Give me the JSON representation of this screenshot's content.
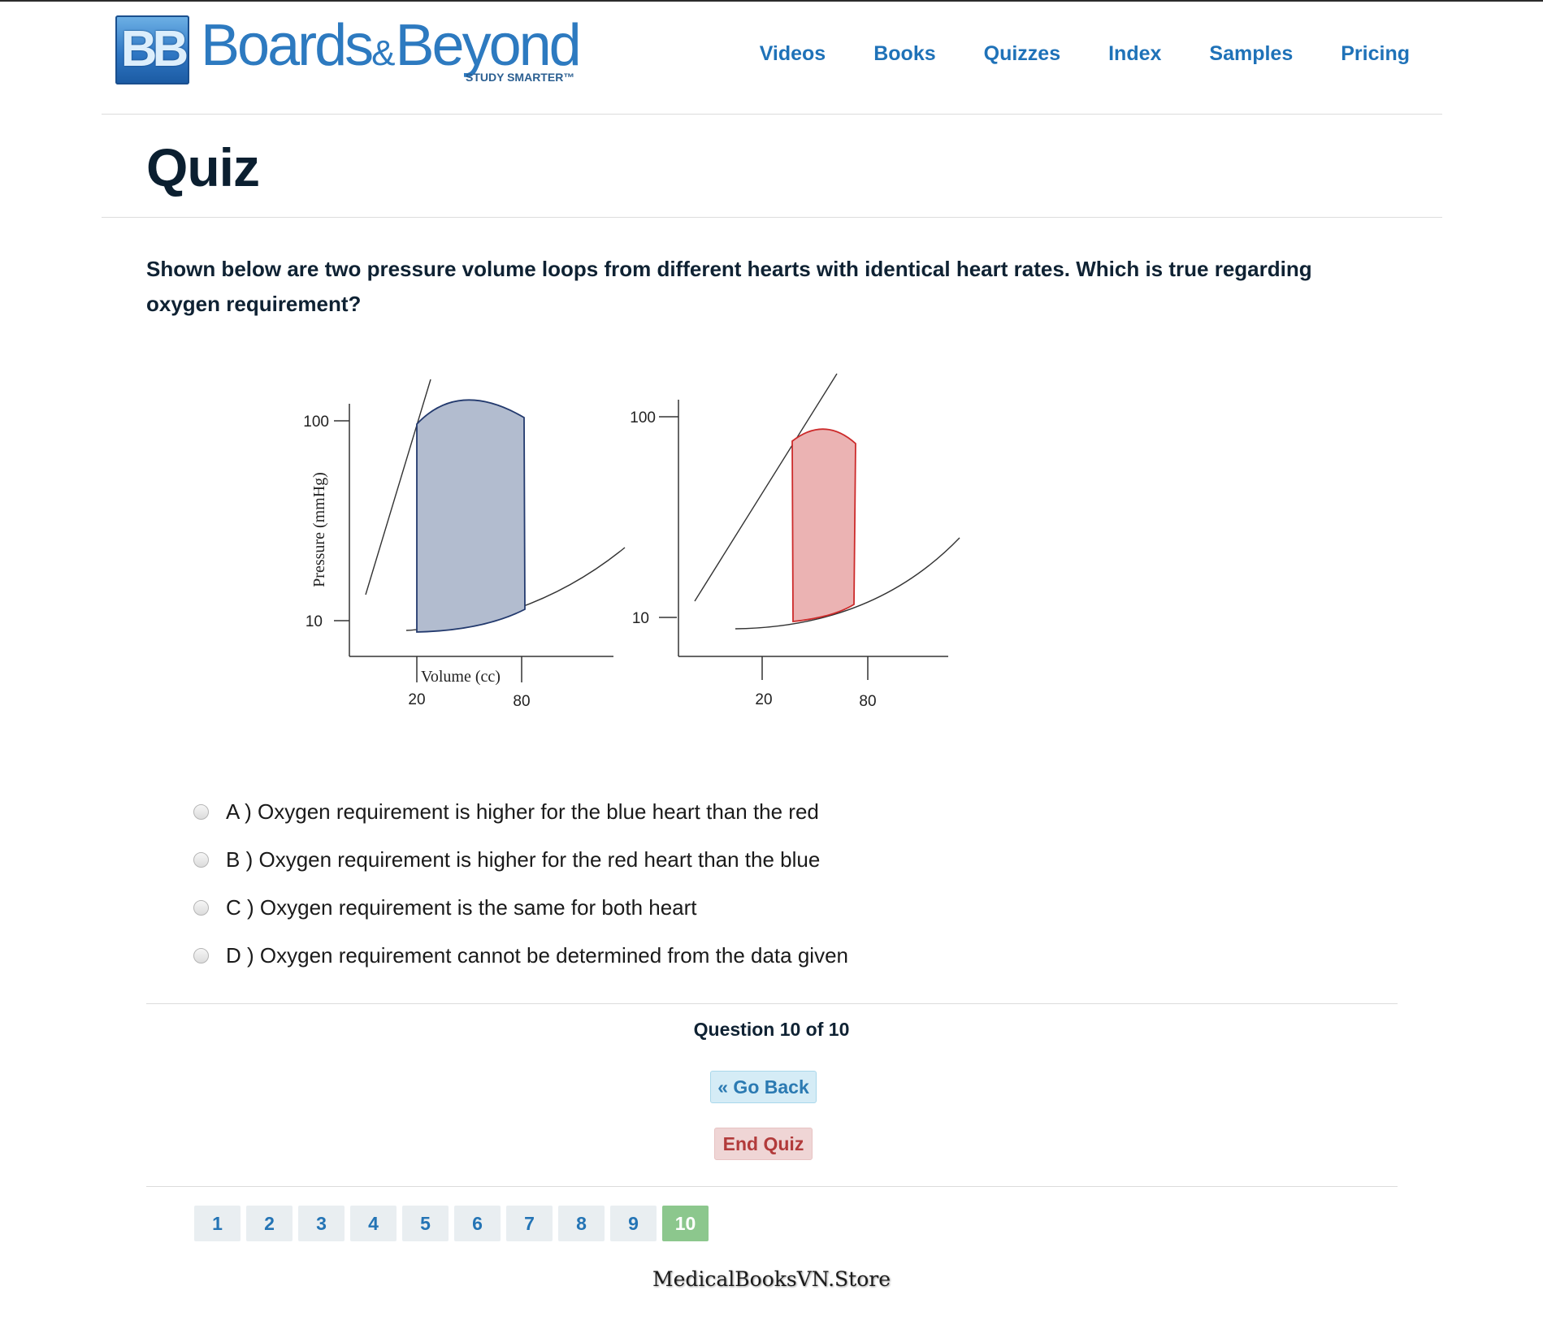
{
  "brand": {
    "badge": "BB",
    "name_part1": "Boards",
    "amp": "&",
    "name_part2": "Beyond",
    "tagline": "STUDY SMARTER™"
  },
  "nav": [
    "Videos",
    "Books",
    "Quizzes",
    "Index",
    "Samples",
    "Pricing"
  ],
  "page_title": "Quiz",
  "question_text": "Shown below are two pressure volume loops from different hearts with identical heart rates. Which is true regarding oxygen requirement?",
  "figure": {
    "ylabel": "Pressure (mmHg)",
    "xlabel": "Volume (cc)",
    "yticks": [
      "100",
      "10"
    ],
    "xticks": [
      "20",
      "80"
    ]
  },
  "options": [
    {
      "letter": "A )",
      "text": "Oxygen requirement is higher for the blue heart than the red"
    },
    {
      "letter": "B )",
      "text": "Oxygen requirement is higher for the red heart than the blue"
    },
    {
      "letter": "C )",
      "text": "Oxygen requirement is the same for both heart"
    },
    {
      "letter": "D )",
      "text": "Oxygen requirement cannot be determined from the data given"
    }
  ],
  "question_counter": "Question 10 of 10",
  "buttons": {
    "go_back": "« Go Back",
    "end_quiz": "End Quiz"
  },
  "pagination": [
    "1",
    "2",
    "3",
    "4",
    "5",
    "6",
    "7",
    "8",
    "9",
    "10"
  ],
  "pagination_active": "10",
  "colors": {
    "blue_loop": "#b2bccf",
    "red_loop": "#ebb3b3",
    "accent": "#1f72b8",
    "active_page": "#8cc78d"
  },
  "watermark": "MedicalBooksVN.Store"
}
